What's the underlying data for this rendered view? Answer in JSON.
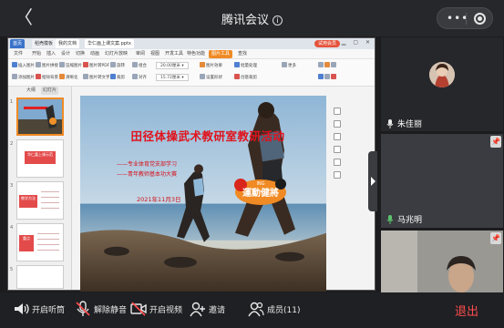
{
  "header": {
    "title": "腾讯会议",
    "info_glyph": "i",
    "back_glyph": "〈",
    "capsule_dots": "•••"
  },
  "wps": {
    "tabs": [
      "首页",
      "稻壳模板",
      "我的文档",
      "华仁画上课文案.pptx"
    ],
    "user_badge": "试用会员",
    "menu": [
      "文件",
      "开始",
      "插入",
      "设计",
      "切换",
      "动画",
      "幻灯片放映",
      "审阅",
      "视图",
      "开发工具",
      "特色功能",
      "图片工具",
      "查找"
    ],
    "active_menu": "图片工具",
    "ribbon_items": [
      "插入图片",
      "添加图片",
      "图片拼接",
      "抠除背景",
      "压缩图片",
      "清晰化",
      "图片转PDF",
      "图片转文字",
      "旋转",
      "裁剪",
      "组合",
      "对齐",
      "图片效果",
      "设置形状",
      "批量处理",
      "创意裁剪",
      "更多"
    ],
    "thumb_pane": {
      "tab_outline": "大纲",
      "tab_slides": "幻灯片"
    },
    "thumbs": [
      {
        "num": "1",
        "label": ""
      },
      {
        "num": "2",
        "label": "华仁嘉上课示范"
      },
      {
        "num": "3",
        "label": "教学方法"
      },
      {
        "num": "4",
        "label": "重点"
      },
      {
        "num": "5",
        "label": ""
      }
    ]
  },
  "slide": {
    "title": "田径体操武术教研室教研活动",
    "subtitle1": "——专业体育党支部学习",
    "subtitle2": "——青年教师基本功大赛",
    "date": "2021年11月3日",
    "logo_text": "運動健將",
    "logo_small": "ING"
  },
  "participants": [
    {
      "name": "朱佳丽"
    },
    {
      "name": "马兆明"
    },
    {
      "name": ""
    }
  ],
  "toolbar": {
    "speaker": "开启听筒",
    "mute": "解除静音",
    "video": "开启视频",
    "invite": "邀请",
    "members": "成员(11)",
    "exit": "退出"
  },
  "colors": {
    "accent_red": "#ff4d4f",
    "slide_title_red": "#e1121b",
    "wps_orange": "#f08a24",
    "wps_blue": "#3a73c9"
  },
  "icons": [
    "back-icon",
    "info-icon",
    "more-dots-icon",
    "record-icon",
    "speaker-icon",
    "mic-muted-icon",
    "video-off-icon",
    "invite-icon",
    "members-icon",
    "pin-icon",
    "mic-icon"
  ]
}
